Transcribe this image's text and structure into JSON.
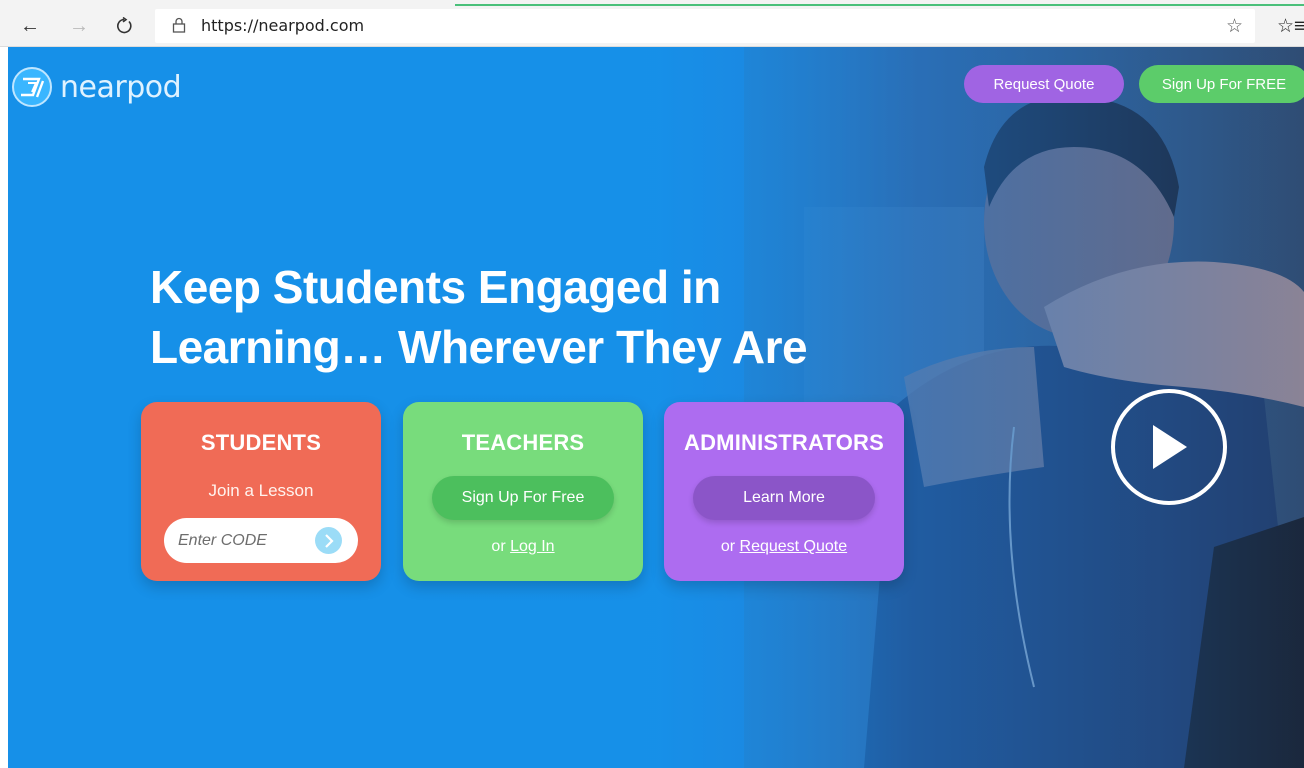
{
  "browser": {
    "url": "https://nearpod.com",
    "icons": {
      "back": "back-arrow-icon",
      "forward": "forward-arrow-icon",
      "refresh": "refresh-icon",
      "lock": "lock-icon",
      "favorite": "star-icon",
      "favorites_bar": "favorites-icon"
    }
  },
  "header": {
    "logo_text": "nearpod",
    "request_quote": "Request Quote",
    "sign_up": "Sign Up For FREE"
  },
  "hero": {
    "headline_line1": "Keep Students Engaged in",
    "headline_line2": "Learning… Wherever They Are"
  },
  "cards": {
    "students": {
      "title": "STUDENTS",
      "subtitle": "Join a Lesson",
      "code_placeholder": "Enter CODE"
    },
    "teachers": {
      "title": "TEACHERS",
      "button": "Sign Up For Free",
      "footer_prefix": "or ",
      "footer_link": "Log In"
    },
    "admins": {
      "title": "ADMINISTRATORS",
      "button": "Learn More",
      "footer_prefix": "or ",
      "footer_link": "Request Quote"
    }
  },
  "colors": {
    "hero_blue": "#1690e8",
    "students": "#f06b56",
    "teachers": "#78dc7c",
    "admins": "#ad6cf0",
    "request_quote_btn": "#a064e3",
    "signup_btn": "#5ccc6a"
  }
}
